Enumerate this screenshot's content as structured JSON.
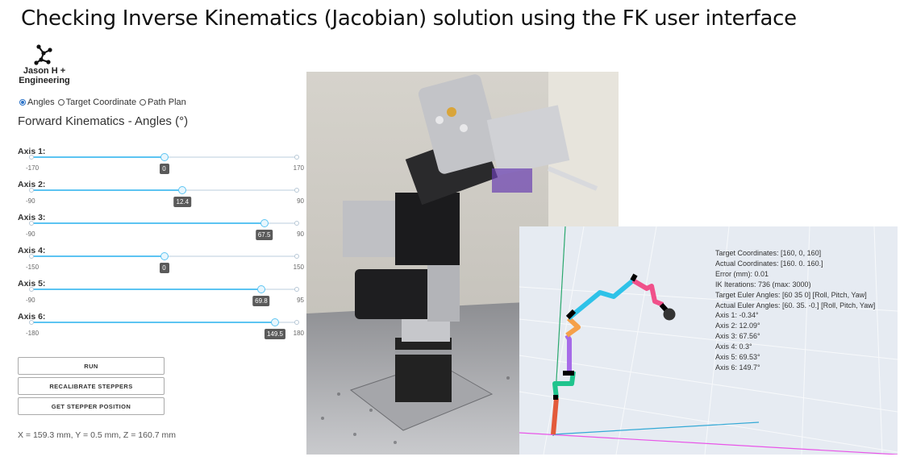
{
  "slide": {
    "title": "Checking Inverse Kinematics (Jacobian) solution using the FK user interface"
  },
  "logo": {
    "line1": "Jason H +",
    "line2": "Engineering"
  },
  "modes": [
    {
      "label": "Angles",
      "selected": true
    },
    {
      "label": "Target Coordinate",
      "selected": false
    },
    {
      "label": "Path Plan",
      "selected": false
    }
  ],
  "fk_title": "Forward Kinematics - Angles (°)",
  "axes": [
    {
      "label": "Axis 1:",
      "min": -170,
      "max": 170,
      "value": 0,
      "min_label": "-170",
      "max_label": "170",
      "value_label": "0"
    },
    {
      "label": "Axis 2:",
      "min": -90,
      "max": 90,
      "value": 12.4,
      "min_label": "-90",
      "max_label": "90",
      "value_label": "12.4"
    },
    {
      "label": "Axis 3:",
      "min": -90,
      "max": 90,
      "value": 67.5,
      "min_label": "-90",
      "max_label": "90",
      "value_label": "67.5"
    },
    {
      "label": "Axis 4:",
      "min": -150,
      "max": 150,
      "value": 0,
      "min_label": "-150",
      "max_label": "150",
      "value_label": "0"
    },
    {
      "label": "Axis 5:",
      "min": -90,
      "max": 95,
      "value": 69.8,
      "min_label": "-90",
      "max_label": "95",
      "value_label": "69.8"
    },
    {
      "label": "Axis 6:",
      "min": -180,
      "max": 180,
      "value": 149.5,
      "min_label": "-180",
      "max_label": "180",
      "value_label": "149.5"
    }
  ],
  "buttons": {
    "run": "RUN",
    "recalibrate": "RECALIBRATE STEPPERS",
    "get_position": "GET STEPPER POSITION"
  },
  "position_readout": "X = 159.3 mm, Y = 0.5 mm, Z = 160.7 mm",
  "plot": {
    "target_coordinates": "Target Coordinates: [160, 0, 160]",
    "actual_coordinates": "Actual Coordinates: [160.   0. 160.]",
    "error": "Error (mm): 0.01",
    "iterations": "IK Iterations: 736 (max: 3000)",
    "target_euler": "Target Euler Angles: [60 35  0] [Roll, Pitch, Yaw]",
    "actual_euler": "Actual Euler Angles: [60. 35. -0.] [Roll, Pitch, Yaw]",
    "axis1": "Axis 1: -0.34°",
    "axis2": "Axis 2: 12.09°",
    "axis3": "Axis 3: 67.56°",
    "axis4": "Axis 4: 0.3°",
    "axis5": "Axis 5: 69.53°",
    "axis6": "Axis 6: 149.7°"
  },
  "colors": {
    "accent": "#5cc4f2",
    "link_base": "#e35a3a",
    "link_2": "#1fc48d",
    "link_3": "#a66be8",
    "link_4": "#f5a04a",
    "link_5": "#2ec2e8",
    "link_6": "#f0508a"
  }
}
